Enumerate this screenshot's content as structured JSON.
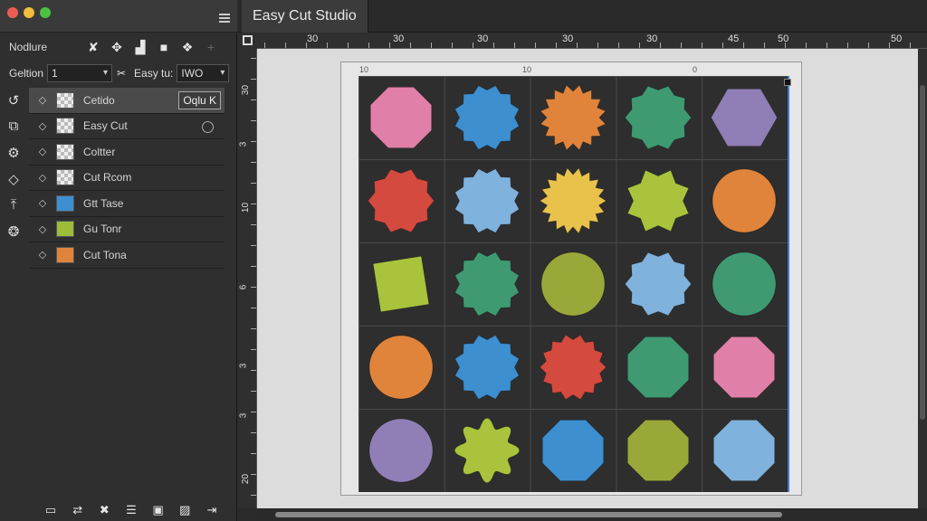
{
  "app": {
    "title": "Easy Cut Studio"
  },
  "toolbar": {
    "label": "Nodlure"
  },
  "fields": {
    "field1_label": "Geltion",
    "field1_value": "1",
    "field2_label": "Easy tu:",
    "field2_value": "IWO"
  },
  "layers": [
    {
      "name": "Cetido",
      "thumb": "checker",
      "badge": "Oqlu K",
      "selected": true
    },
    {
      "name": "Easy Cut",
      "thumb": "checker",
      "circle": true
    },
    {
      "name": "Coltter",
      "thumb": "checker"
    },
    {
      "name": "Cut Rcom",
      "thumb": "checker"
    },
    {
      "name": "Gtt Tase",
      "thumb": "#3d8fd0"
    },
    {
      "name": "Gu Tonr",
      "thumb": "#9fbb3a"
    },
    {
      "name": "Cut Tona",
      "thumb": "#e0843c"
    }
  ],
  "ruler_top_labels": [
    "30",
    "30",
    "30",
    "30",
    "30",
    "45",
    "50",
    "50"
  ],
  "ruler_left_labels": [
    "30",
    "3",
    "10",
    "6",
    "3",
    "3",
    "20"
  ],
  "page_numbers": [
    "10",
    "10",
    "0"
  ],
  "shape_colors": {
    "pink": "#e07fa8",
    "blue": "#3d8fd0",
    "orange": "#e0843c",
    "teal": "#3f9a72",
    "purple": "#8f7fb6",
    "red": "#d44a3f",
    "lightblue": "#7fb2dc",
    "yellow": "#e9c24c",
    "lime": "#a9c43c",
    "olive": "#9aa83a"
  },
  "shapes": [
    [
      "pink:octagon",
      "blue:star12",
      "orange:star16",
      "teal:star10",
      "purple:hexagon"
    ],
    [
      "red:star10",
      "lightblue:star12",
      "yellow:star18",
      "lime:star8",
      "orange:circle"
    ],
    [
      "lime:square",
      "teal:star12",
      "olive:circle",
      "lightblue:star10",
      "teal:circle"
    ],
    [
      "orange:circle",
      "blue:star12",
      "red:star14",
      "teal:octagon",
      "pink:octagon"
    ],
    [
      "purple:circle",
      "lime:flower",
      "blue:octagon",
      "olive:octagon",
      "lightblue:octagon"
    ]
  ]
}
